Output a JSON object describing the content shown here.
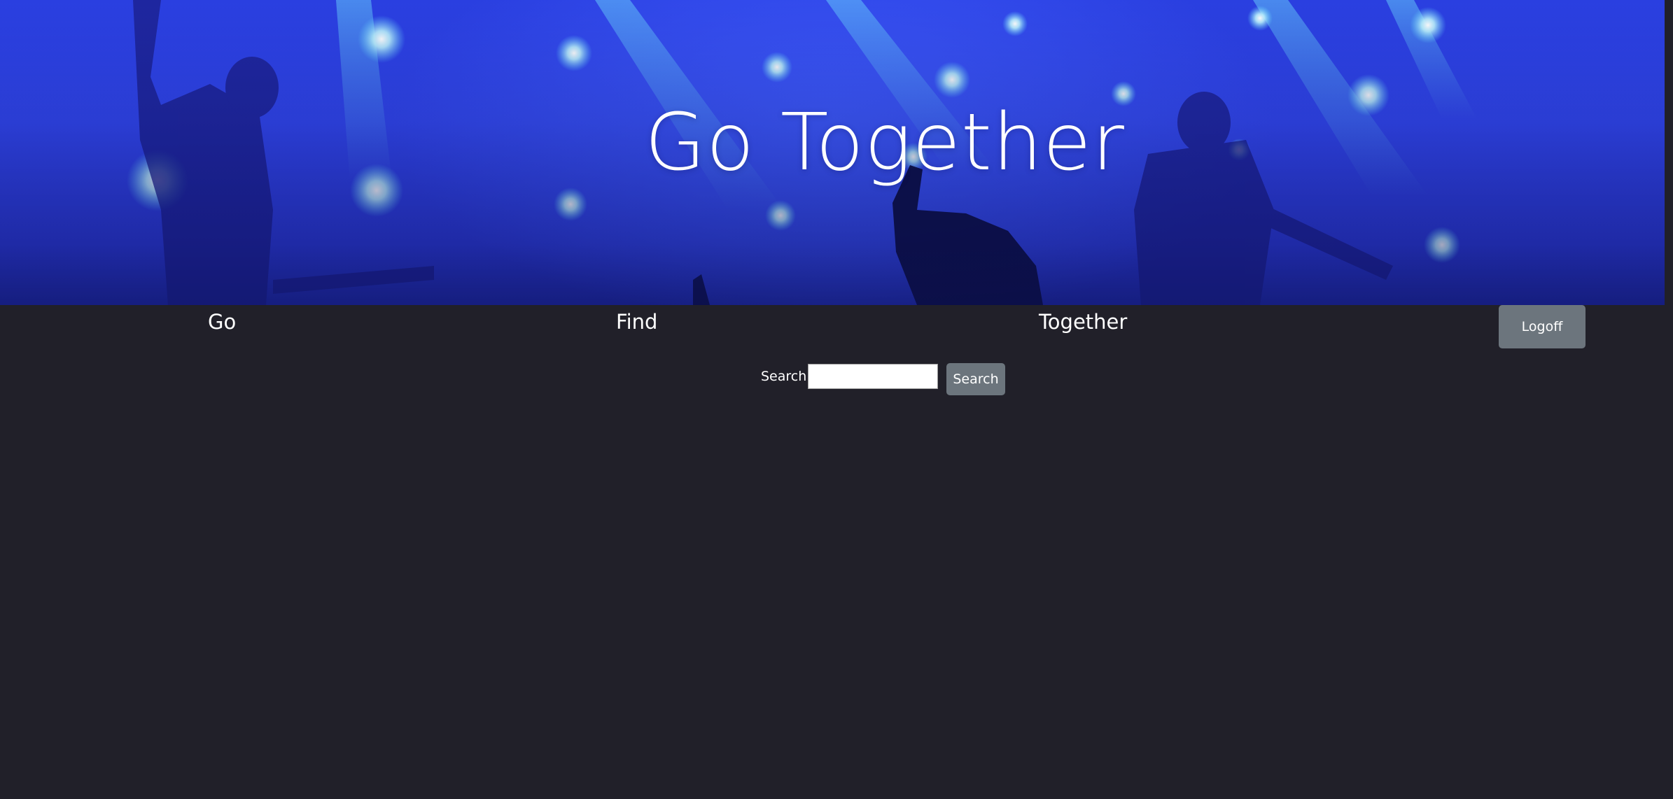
{
  "hero": {
    "title": "Go Together",
    "background_image": "concert-stage-blue-lights"
  },
  "nav": {
    "items": [
      {
        "label": "Go"
      },
      {
        "label": "Find"
      },
      {
        "label": "Together"
      }
    ],
    "logoff_label": "Logoff"
  },
  "search": {
    "label": "Search:",
    "value": "",
    "placeholder": "",
    "button_label": "Search"
  },
  "colors": {
    "page_background": "#212029",
    "button_background": "#6c757d",
    "hero_blue": "#3349f2",
    "text": "#ffffff"
  }
}
